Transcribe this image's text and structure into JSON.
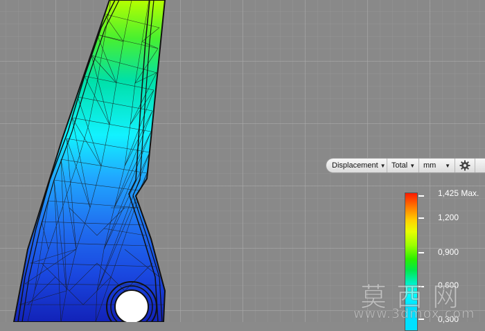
{
  "toolbar": {
    "result_type": "Displacement",
    "component": "Total",
    "unit": "mm",
    "settings_icon": "gear-icon"
  },
  "legend": {
    "labels": [
      "1,425 Max.",
      "1,200",
      "0,900",
      "0,600",
      "0,300"
    ]
  },
  "watermark": {
    "chars": "莫西网",
    "url": "www.3dmox.com"
  },
  "colors": {
    "viewport_bg": "#898989",
    "mesh_line": "#1a1a1a"
  }
}
